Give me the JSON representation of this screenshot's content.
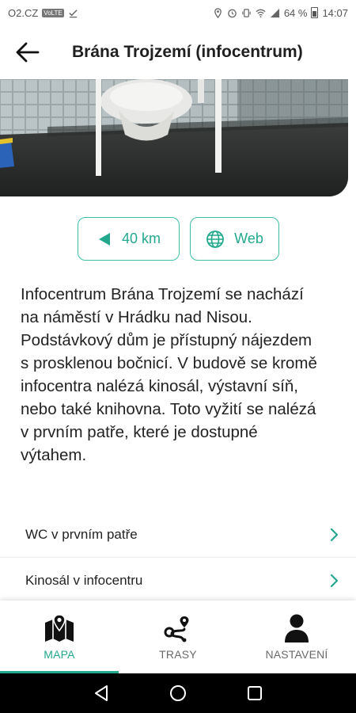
{
  "status_bar": {
    "carrier": "O2.CZ",
    "badge": "VoLTE",
    "battery": "64 %",
    "time": "14:07"
  },
  "header": {
    "title": "Brána Trojzemí (infocentrum)"
  },
  "actions": {
    "distance": "40 km",
    "web": "Web"
  },
  "description": "Infocentrum Brána Trojzemí se nachází na náměstí v Hrádku nad Nisou. Podstávkový dům je přístupný nájezdem s proskleno­u bočnicí. V budově se kromě infocentra nalézá kinosál, výstavní síň, nebo také knihovna. Toto vyžití se nalézá v prvním patře, které je dostupné výtahem.",
  "list": [
    {
      "label": "WC v prvním patře"
    },
    {
      "label": "Kinosál v infocentru"
    }
  ],
  "nav": [
    {
      "label": "MAPA",
      "icon": "map-icon",
      "active": true
    },
    {
      "label": "TRASY",
      "icon": "route-icon",
      "active": false
    },
    {
      "label": "NASTAVENÍ",
      "icon": "user-icon",
      "active": false
    }
  ],
  "colors": {
    "accent": "#23a88e"
  }
}
